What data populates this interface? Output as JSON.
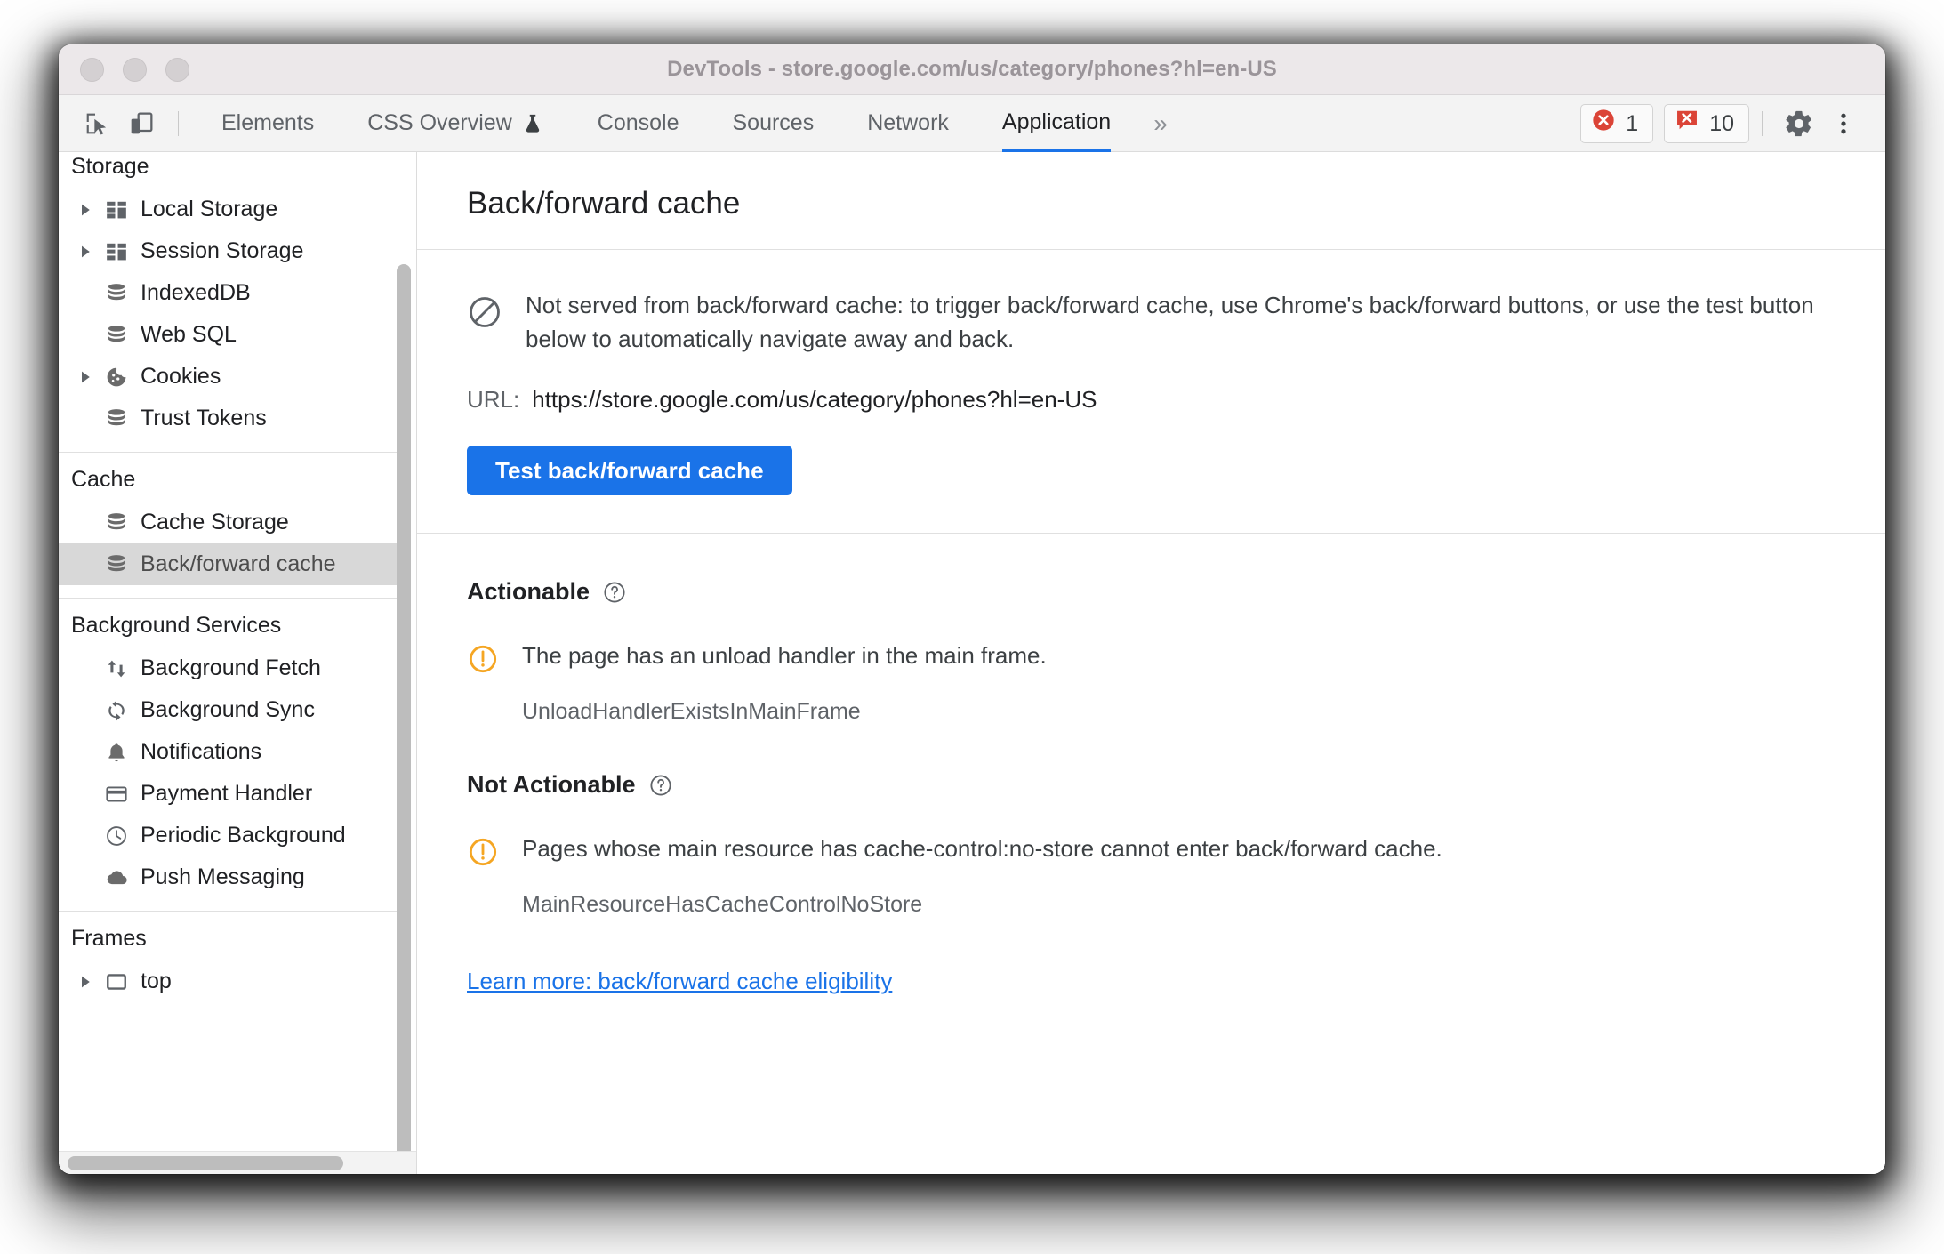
{
  "window": {
    "title": "DevTools - store.google.com/us/category/phones?hl=en-US"
  },
  "toolbar": {
    "inspect_icon": "inspect-element-icon",
    "device_icon": "device-toolbar-icon",
    "tabs": [
      {
        "label": "Elements",
        "active": false
      },
      {
        "label": "CSS Overview",
        "active": false,
        "badge": "experiment-flask-icon"
      },
      {
        "label": "Console",
        "active": false
      },
      {
        "label": "Sources",
        "active": false
      },
      {
        "label": "Network",
        "active": false
      },
      {
        "label": "Application",
        "active": true
      }
    ],
    "more_tabs_label": "»",
    "errors": {
      "icon": "error-circle-icon",
      "count": "1"
    },
    "issues": {
      "icon": "issue-bubble-icon",
      "count": "10"
    },
    "settings_icon": "gear-icon",
    "more_options_icon": "kebab-menu-icon"
  },
  "sidebar": {
    "groups": [
      {
        "title": "Storage",
        "title_clipped": true,
        "items": [
          {
            "label": "Local Storage",
            "icon": "table-icon",
            "expandable": true,
            "selected": false
          },
          {
            "label": "Session Storage",
            "icon": "table-icon",
            "expandable": true,
            "selected": false
          },
          {
            "label": "IndexedDB",
            "icon": "database-icon",
            "expandable": false,
            "selected": false
          },
          {
            "label": "Web SQL",
            "icon": "database-icon",
            "expandable": false,
            "selected": false
          },
          {
            "label": "Cookies",
            "icon": "cookie-icon",
            "expandable": true,
            "selected": false
          },
          {
            "label": "Trust Tokens",
            "icon": "database-icon",
            "expandable": false,
            "selected": false
          }
        ]
      },
      {
        "title": "Cache",
        "items": [
          {
            "label": "Cache Storage",
            "icon": "database-icon",
            "expandable": false,
            "selected": false
          },
          {
            "label": "Back/forward cache",
            "icon": "database-icon",
            "expandable": false,
            "selected": true
          }
        ]
      },
      {
        "title": "Background Services",
        "items": [
          {
            "label": "Background Fetch",
            "icon": "updown-arrows-icon",
            "expandable": false,
            "selected": false
          },
          {
            "label": "Background Sync",
            "icon": "sync-icon",
            "expandable": false,
            "selected": false
          },
          {
            "label": "Notifications",
            "icon": "bell-icon",
            "expandable": false,
            "selected": false
          },
          {
            "label": "Payment Handler",
            "icon": "credit-card-icon",
            "expandable": false,
            "selected": false
          },
          {
            "label": "Periodic Background",
            "icon": "clock-icon",
            "expandable": false,
            "selected": false
          },
          {
            "label": "Push Messaging",
            "icon": "cloud-icon",
            "expandable": false,
            "selected": false
          }
        ]
      },
      {
        "title": "Frames",
        "items": [
          {
            "label": "top",
            "icon": "frame-icon",
            "expandable": true,
            "selected": false
          }
        ]
      }
    ]
  },
  "main": {
    "title": "Back/forward cache",
    "status": {
      "icon": "not-allowed-icon",
      "text": "Not served from back/forward cache: to trigger back/forward cache, use Chrome's back/forward buttons, or use the test button below to automatically navigate away and back."
    },
    "url": {
      "label": "URL:",
      "value": "https://store.google.com/us/category/phones?hl=en-US"
    },
    "test_button_label": "Test back/forward cache",
    "sections": [
      {
        "heading": "Actionable",
        "help_icon": "help-circle-icon",
        "issues": [
          {
            "icon": "warning-circle-icon",
            "text": "The page has an unload handler in the main frame.",
            "code": "UnloadHandlerExistsInMainFrame"
          }
        ]
      },
      {
        "heading": "Not Actionable",
        "help_icon": "help-circle-icon",
        "issues": [
          {
            "icon": "warning-circle-icon",
            "text": "Pages whose main resource has cache-control:no-store cannot enter back/forward cache.",
            "code": "MainResourceHasCacheControlNoStore"
          }
        ]
      }
    ],
    "learn_more_label": "Learn more: back/forward cache eligibility"
  },
  "colors": {
    "accent_blue": "#1a73e8",
    "warning_orange": "#f5a623",
    "error_red": "#db4437",
    "titlebar": "#ece8ea",
    "selected_row": "#d8d8d8"
  }
}
